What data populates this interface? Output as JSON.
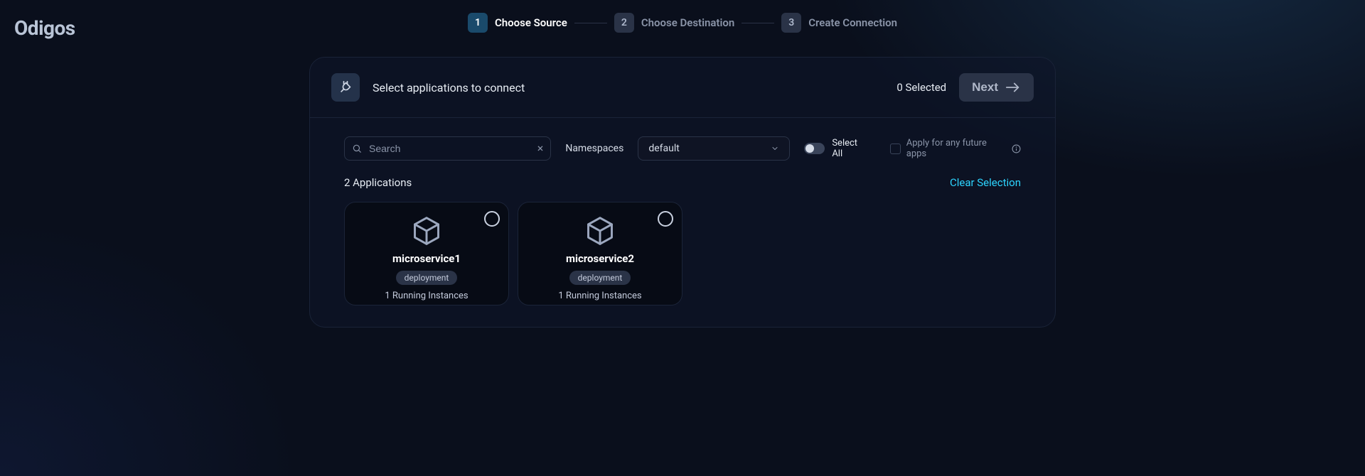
{
  "brand": "Odigos",
  "steps": [
    {
      "num": "1",
      "label": "Choose Source",
      "active": true
    },
    {
      "num": "2",
      "label": "Choose Destination",
      "active": false
    },
    {
      "num": "3",
      "label": "Create Connection",
      "active": false
    }
  ],
  "header": {
    "title": "Select applications to connect",
    "selected_count": "0",
    "selected_word": "Selected",
    "next_label": "Next"
  },
  "filters": {
    "search_placeholder": "Search",
    "namespaces_label": "Namespaces",
    "namespace_selected": "default",
    "select_all_label": "Select All",
    "future_apps_label": "Apply for any future apps"
  },
  "apps_header": {
    "count_text": "2 Applications",
    "clear_label": "Clear Selection"
  },
  "apps": [
    {
      "name": "microservice1",
      "kind": "deployment",
      "instances": "1 Running Instances"
    },
    {
      "name": "microservice2",
      "kind": "deployment",
      "instances": "1 Running Instances"
    }
  ]
}
